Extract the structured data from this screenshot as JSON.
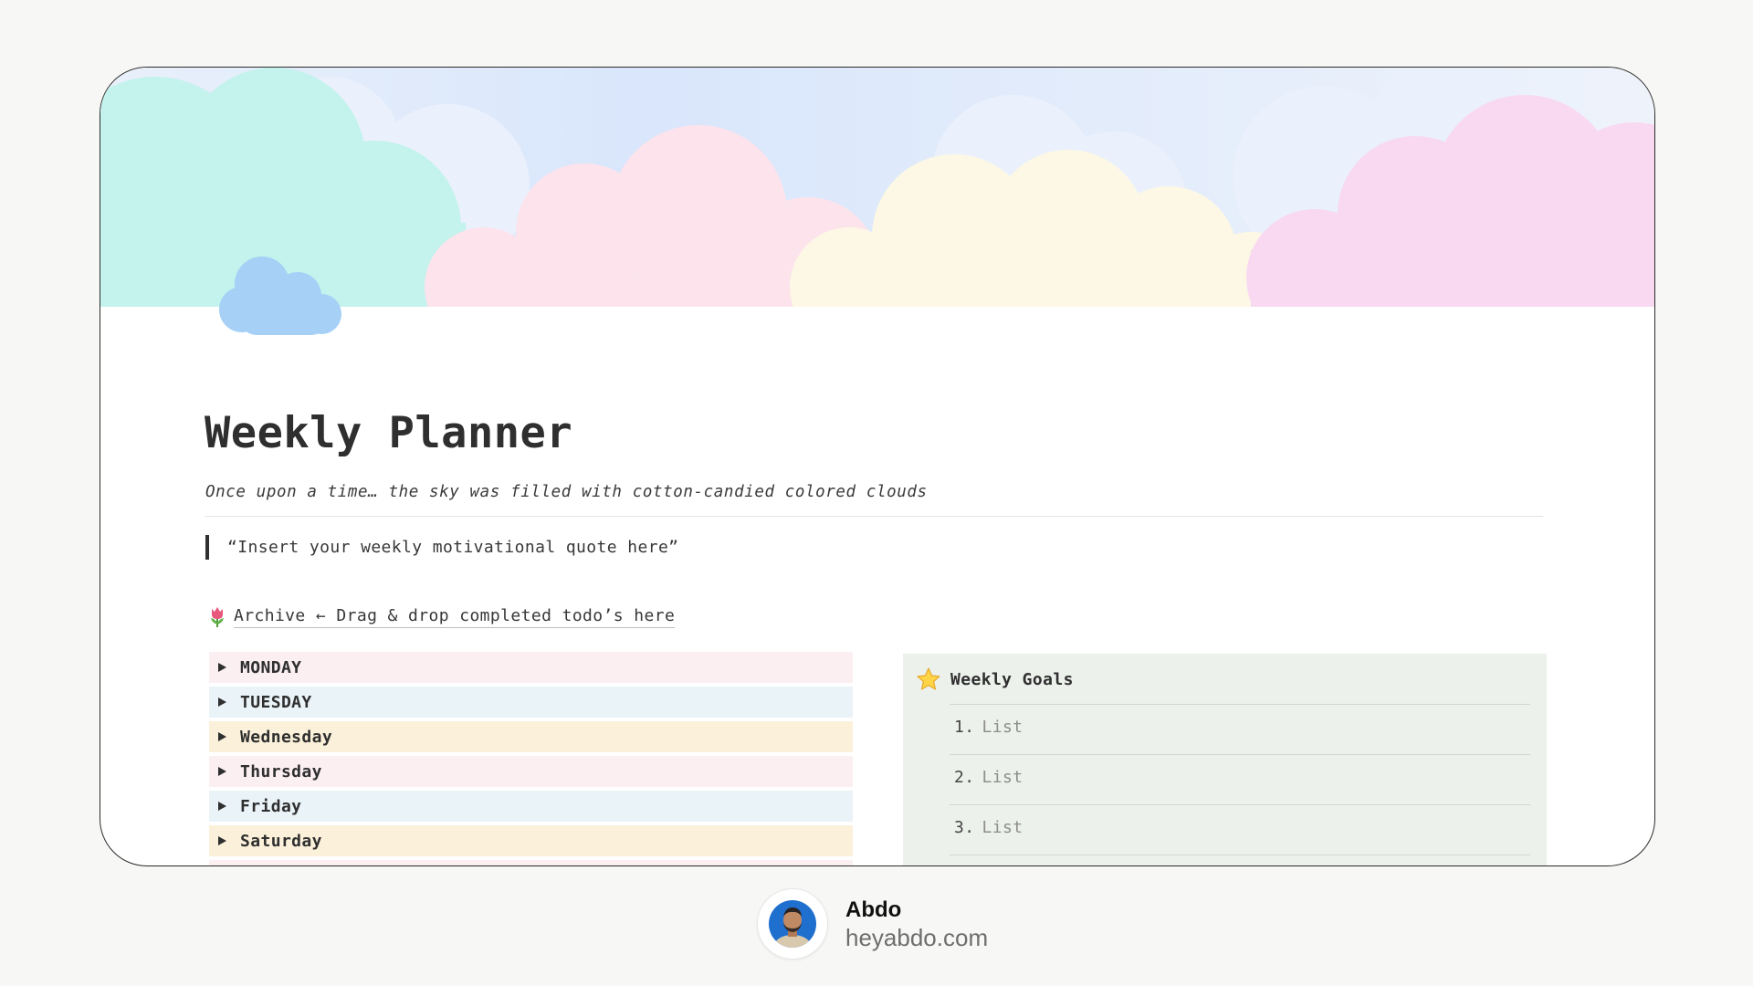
{
  "page": {
    "title": "Weekly Planner",
    "subtitle": "Once upon a time… the sky was filled with cotton-candied colored clouds",
    "quote": "“Insert your weekly motivational quote here”",
    "archive_icon": "tulip-icon",
    "archive_link": "Archive ← Drag & drop completed todo’s here",
    "cover_icon": "cloud-icon"
  },
  "days": [
    {
      "label": "MONDAY",
      "color": "#fbeff2"
    },
    {
      "label": "TUESDAY",
      "color": "#eaf3f8"
    },
    {
      "label": "Wednesday",
      "color": "#fbf1da"
    },
    {
      "label": "Thursday",
      "color": "#fbeff2"
    },
    {
      "label": "Friday",
      "color": "#eaf3f8"
    },
    {
      "label": "Saturday",
      "color": "#fbf1da"
    }
  ],
  "goals": {
    "icon": "star-icon",
    "title": "Weekly Goals",
    "items": [
      {
        "num": "1.",
        "text": "List"
      },
      {
        "num": "2.",
        "text": "List"
      },
      {
        "num": "3.",
        "text": "List"
      }
    ]
  },
  "footer": {
    "name": "Abdo",
    "site": "heyabdo.com"
  },
  "colors": {
    "sky": "#dde9fb",
    "cloud_mint": "#c4f2ec",
    "cloud_pink": "#fde3ec",
    "cloud_cream": "#fcf8e5",
    "cloud_lilac": "#f8d9f1",
    "icon_cloud": "#a6d0f6"
  }
}
